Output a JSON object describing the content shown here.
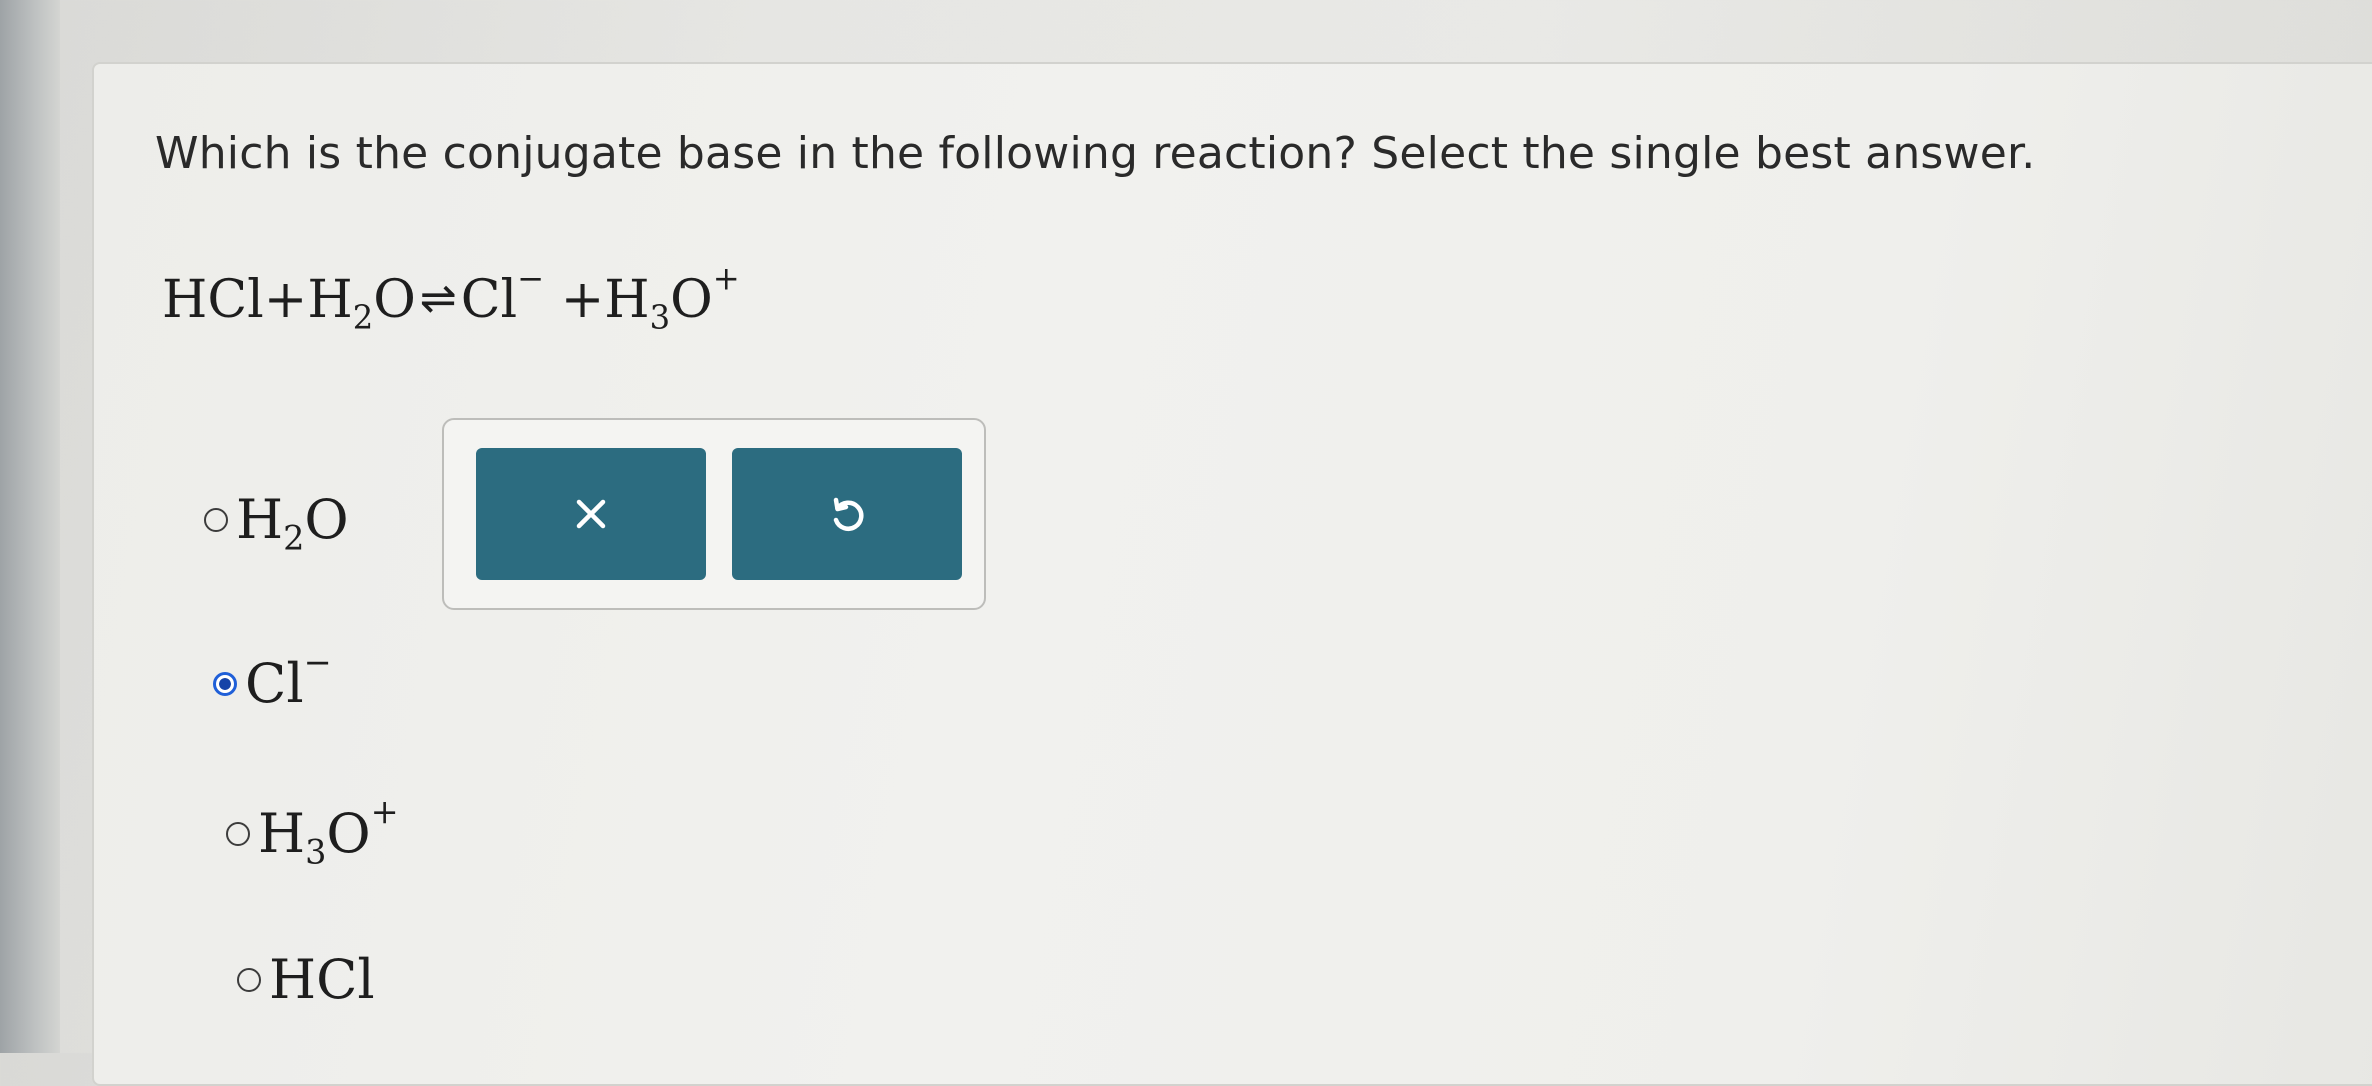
{
  "question": {
    "text": "Which is the conjugate base in the following reaction? Select the single best answer."
  },
  "equation": {
    "reactant1": "HCl",
    "plus1": "+",
    "reactant2_base": "H",
    "reactant2_sub": "2",
    "reactant2_tail": "O",
    "arrow": "⇌",
    "product1_base": "Cl",
    "product1_charge": "−",
    "plus2": "+",
    "product2_base": "H",
    "product2_sub": "3",
    "product2_tail": "O",
    "product2_charge": "+"
  },
  "options": [
    {
      "base": "H",
      "sub": "2",
      "tail": "O",
      "charge": "",
      "selected": false
    },
    {
      "base": "Cl",
      "sub": "",
      "tail": "",
      "charge": "−",
      "selected": true
    },
    {
      "base": "H",
      "sub": "3",
      "tail": "O",
      "charge": "+",
      "selected": false
    },
    {
      "base": "HCl",
      "sub": "",
      "tail": "",
      "charge": "",
      "selected": false
    }
  ],
  "toolbar": {
    "clear_icon": "close-icon",
    "undo_icon": "undo-icon"
  },
  "colors": {
    "button": "#2c6c80",
    "radio_selected": "#1f5fd8"
  }
}
